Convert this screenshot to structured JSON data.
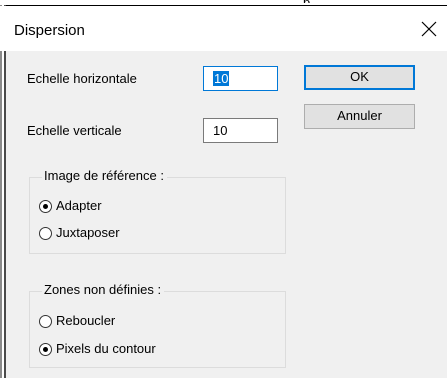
{
  "window": {
    "title_fragment": "p",
    "title": "Dispersion",
    "close_icon": "close-icon"
  },
  "scale": {
    "horizontal_label": "Echelle horizontale",
    "horizontal_value": "10",
    "vertical_label": "Echelle verticale",
    "vertical_value": "10"
  },
  "buttons": {
    "ok": "OK",
    "cancel": "Annuler"
  },
  "reference_image": {
    "legend": "Image de référence :",
    "options": [
      {
        "label": "Adapter",
        "selected": true
      },
      {
        "label": "Juxtaposer",
        "selected": false
      }
    ]
  },
  "undefined_zones": {
    "legend": "Zones non définies :",
    "options": [
      {
        "label": "Reboucler",
        "selected": false
      },
      {
        "label": "Pixels du contour",
        "selected": true
      }
    ]
  },
  "colors": {
    "accent": "#0078d7",
    "dialog_background": "#f0f0f0"
  }
}
